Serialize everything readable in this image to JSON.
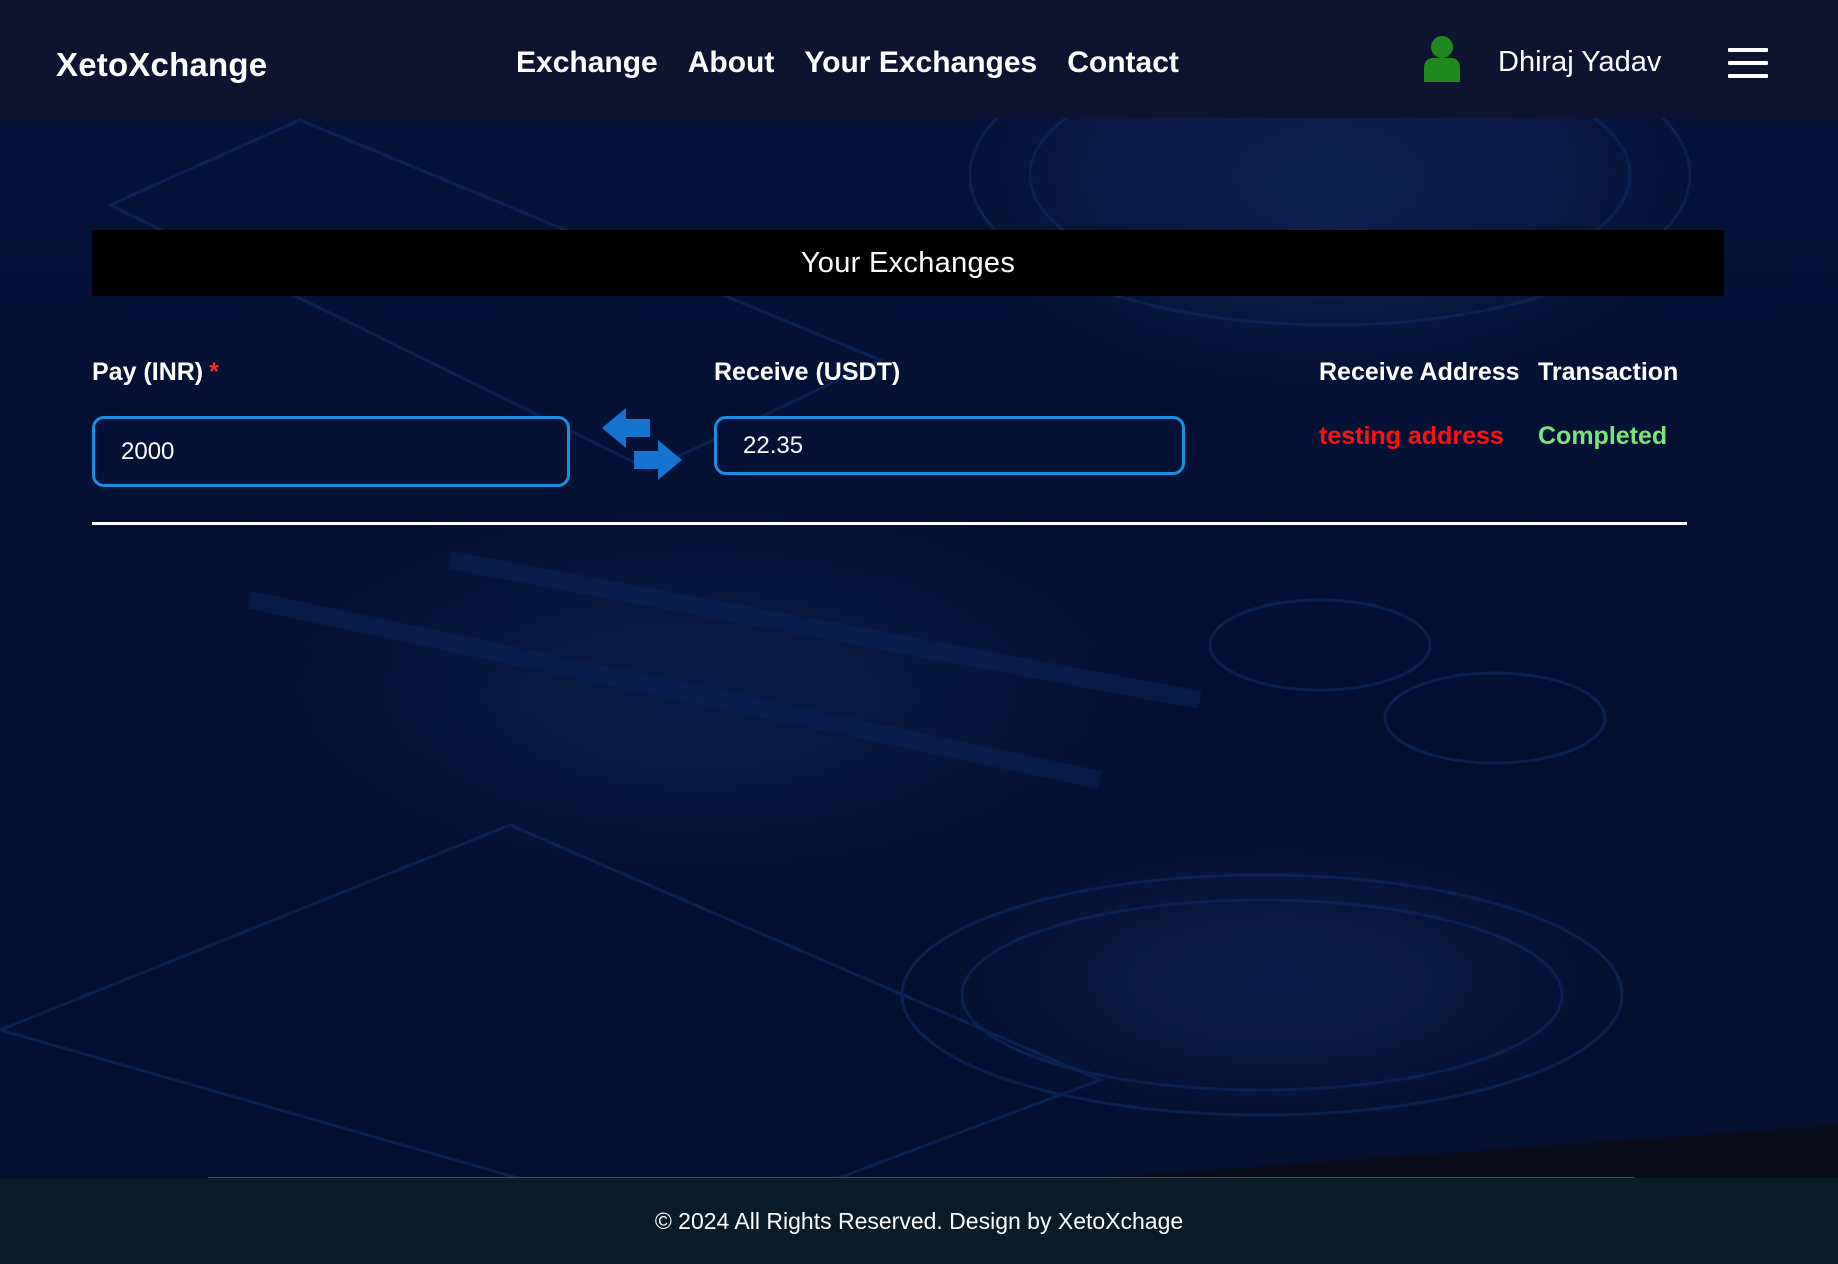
{
  "brand": "XetoXchange",
  "nav": [
    "Exchange",
    "About",
    "Your Exchanges",
    "Contact"
  ],
  "user": {
    "name": "Dhiraj Yadav",
    "icon": "user-icon",
    "icon_color": "#1e8a1e"
  },
  "page_title": "Your Exchanges",
  "form": {
    "pay_label": "Pay (INR)",
    "required_mark": "*",
    "pay_value": "2000",
    "receive_label": "Receive (USDT)",
    "receive_value": "22.35",
    "swap_icon": "swap-arrows-icon",
    "accent": "#1a8fe0"
  },
  "columns": {
    "address_header": "Receive Address",
    "transaction_header": "Transaction"
  },
  "row": {
    "address": "testing address",
    "transaction": "Completed",
    "address_color": "#ff1010",
    "transaction_color": "#7ce27c"
  },
  "footer": {
    "text": "© 2024 All Rights Reserved. Design by XetoXchage"
  }
}
